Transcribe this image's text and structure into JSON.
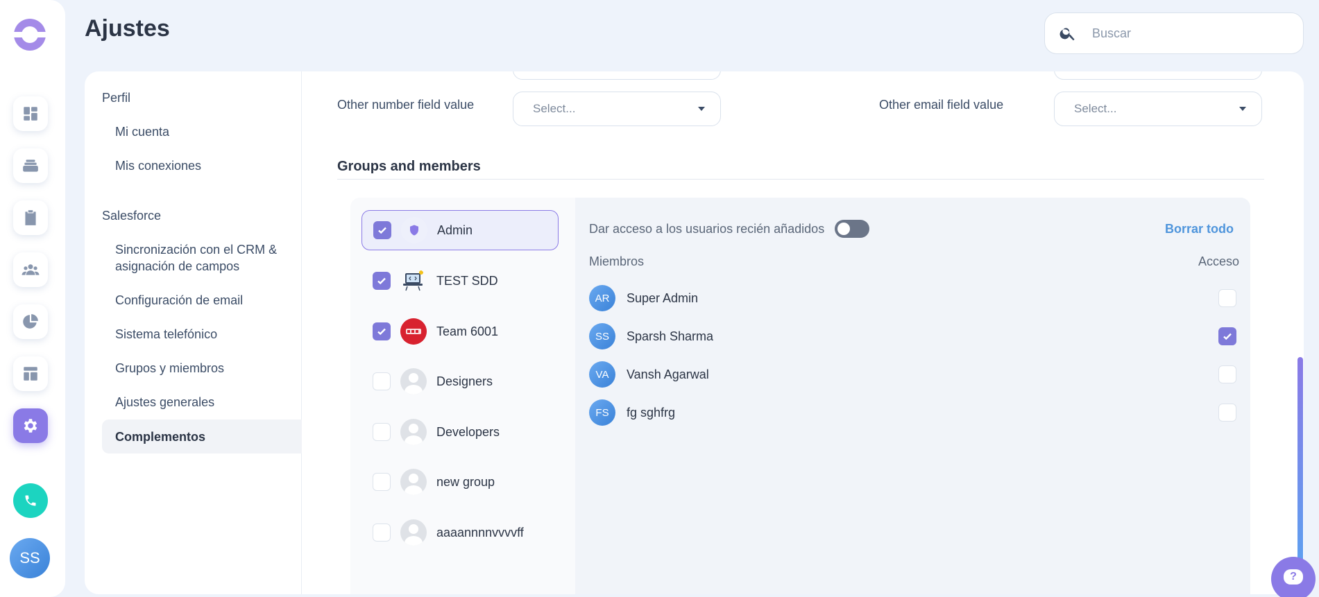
{
  "header": {
    "title": "Ajustes",
    "search_placeholder": "Buscar"
  },
  "settings_nav": {
    "sections": [
      {
        "label": "Perfil",
        "items": [
          "Mi cuenta",
          "Mis conexiones"
        ]
      },
      {
        "label": "Salesforce",
        "items": [
          "Sincronización con el CRM & asignación de campos",
          "Configuración de email",
          "Sistema telefónico",
          "Grupos y miembros",
          "Ajustes generales",
          "Complementos"
        ]
      }
    ],
    "active_item": "Complementos"
  },
  "fields": {
    "number_label": "Other number field value",
    "number_placeholder": "Select...",
    "email_label": "Other email field value",
    "email_placeholder": "Select..."
  },
  "groups_section": {
    "title": "Groups and members",
    "groups": [
      {
        "name": "Admin",
        "checked": true,
        "selected": true,
        "avatar": "shield-icon"
      },
      {
        "name": "TEST SDD",
        "checked": true,
        "selected": false,
        "avatar": "laptop-icon"
      },
      {
        "name": "Team 6001",
        "checked": true,
        "selected": false,
        "avatar": "team-logo"
      },
      {
        "name": "Designers",
        "checked": false,
        "selected": false,
        "avatar": "default-avatar"
      },
      {
        "name": "Developers",
        "checked": false,
        "selected": false,
        "avatar": "default-avatar"
      },
      {
        "name": "new group",
        "checked": false,
        "selected": false,
        "avatar": "default-avatar"
      },
      {
        "name": "aaaannnnvvvvff",
        "checked": false,
        "selected": false,
        "avatar": "default-avatar"
      }
    ],
    "toggle_label": "Dar acceso a los usuarios recién añadidos",
    "toggle_on": false,
    "clear_all": "Borrar todo",
    "members_header": "Miembros",
    "access_header": "Acceso",
    "members": [
      {
        "initials": "AR",
        "name": "Super Admin",
        "access": false
      },
      {
        "initials": "SS",
        "name": "Sparsh Sharma",
        "access": true
      },
      {
        "initials": "VA",
        "name": "Vansh Agarwal",
        "access": false
      },
      {
        "initials": "FS",
        "name": "fg sghfrg",
        "access": false
      }
    ]
  },
  "user": {
    "initials": "SS"
  },
  "colors": {
    "accent": "#8a7ae6",
    "link": "#4f95dc",
    "teal": "#1cd4c0"
  }
}
